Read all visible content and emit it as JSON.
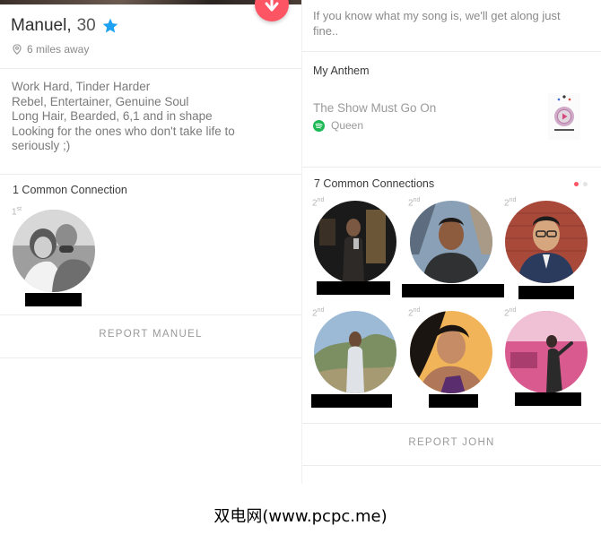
{
  "left": {
    "name": "Manuel,",
    "age": "30",
    "distance": "6 miles away",
    "bio": [
      "Work Hard, Tinder Harder",
      "Rebel, Entertainer, Genuine Soul",
      "Long Hair, Bearded, 6,1 and in shape",
      "Looking for the ones who don't take life to",
      "seriously ;)"
    ],
    "connections_title": "1 Common Connection",
    "connections": [
      {
        "degree": "1",
        "degree_suffix": "st"
      }
    ],
    "report": "REPORT MANUEL"
  },
  "right": {
    "song_intro": "If you know what my song is, we'll get along just fine..",
    "anthem_title": "My Anthem",
    "song": "The Show Must Go On",
    "artist": "Queen",
    "connections_title": "7 Common Connections",
    "connections": [
      {
        "degree": "2",
        "degree_suffix": "nd"
      },
      {
        "degree": "2",
        "degree_suffix": "nd"
      },
      {
        "degree": "2",
        "degree_suffix": "nd"
      },
      {
        "degree": "2",
        "degree_suffix": "nd"
      },
      {
        "degree": "2",
        "degree_suffix": "nd"
      },
      {
        "degree": "2",
        "degree_suffix": "nd"
      }
    ],
    "report": "REPORT JOHN"
  },
  "colors": {
    "brand": "#fd5564",
    "verified": "#1da1f2",
    "spotify": "#1db954"
  },
  "icons": {
    "fab": "arrow-down-icon",
    "verified": "star-verified-icon",
    "location": "location-pin-icon",
    "spotify": "spotify-icon"
  },
  "watermark": "双电网(www.pcpc.me)"
}
